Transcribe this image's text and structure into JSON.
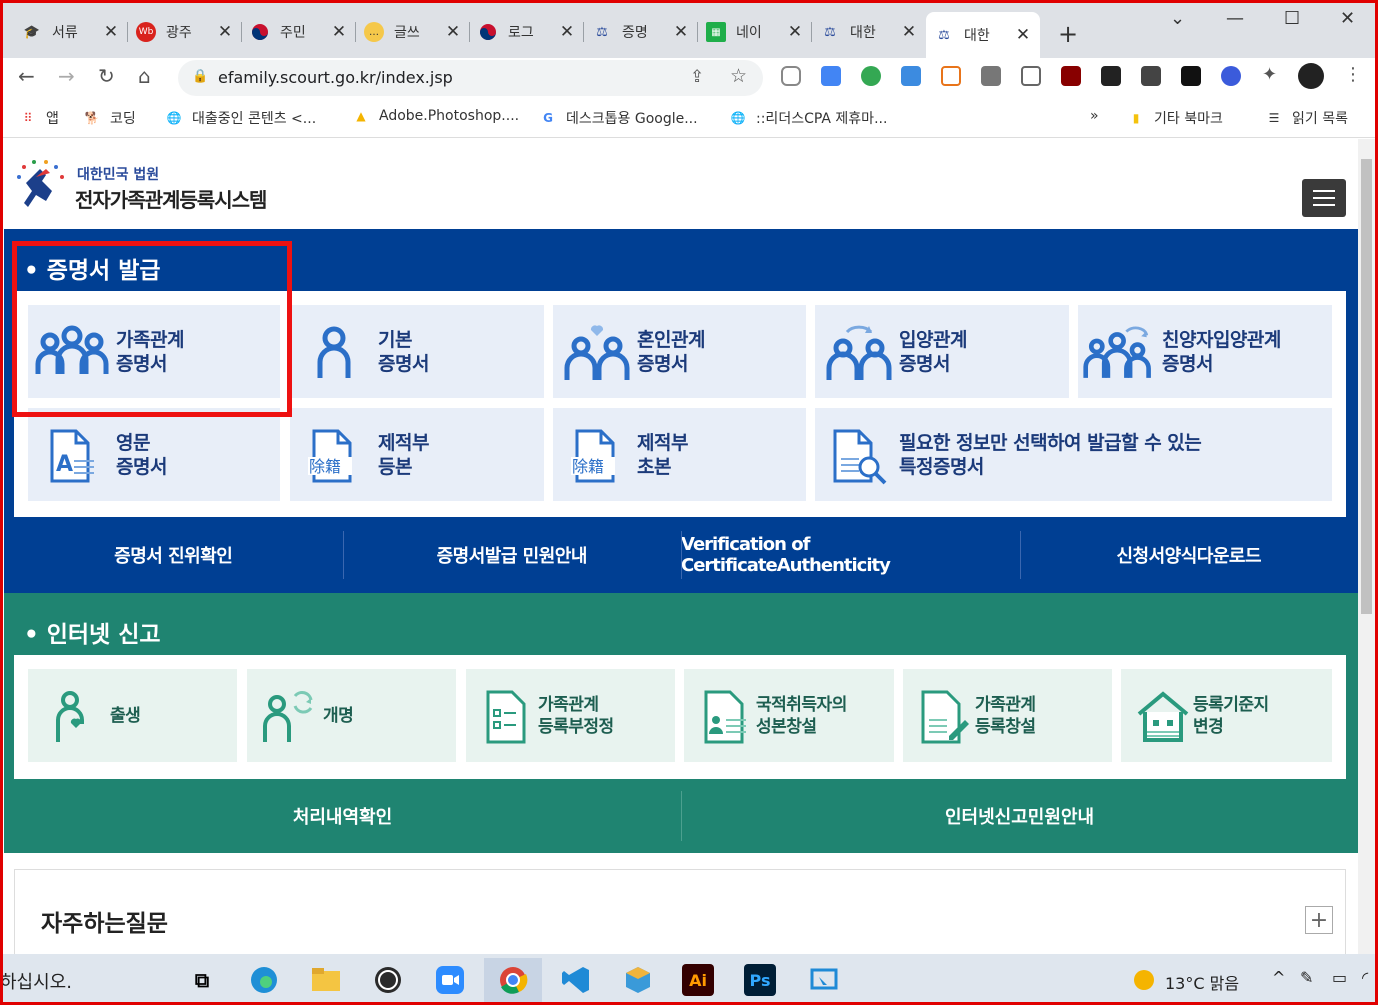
{
  "browser": {
    "tabs": [
      {
        "title": "서류"
      },
      {
        "title": "광주"
      },
      {
        "title": "주민"
      },
      {
        "title": "글쓰"
      },
      {
        "title": "로그"
      },
      {
        "title": "증명"
      },
      {
        "title": "네이"
      },
      {
        "title": "대한"
      },
      {
        "title": "대한"
      }
    ],
    "new_tab": "+",
    "url": "efamily.scourt.go.kr/index.jsp",
    "bookmarks": [
      {
        "label": "앱"
      },
      {
        "label": "코딩"
      },
      {
        "label": "대출중인 콘텐츠 <..."
      },
      {
        "label": "Adobe.Photoshop...."
      },
      {
        "label": "데스크톱용 Google..."
      },
      {
        "label": "::리더스CPA 제휴마..."
      }
    ],
    "bookmarks_more": "»",
    "other_bookmarks": "기타 북마크",
    "reading_list": "읽기 목록"
  },
  "site": {
    "logo_sub": "대한민국 법원",
    "logo_title": "전자가족관계등록시스템"
  },
  "cert": {
    "title": "• 증명서 발급",
    "cards": [
      {
        "line1": "가족관계",
        "line2": "증명서",
        "icon": "family-icon"
      },
      {
        "line1": "기본",
        "line2": "증명서",
        "icon": "person-icon"
      },
      {
        "line1": "혼인관계",
        "line2": "증명서",
        "icon": "marriage-icon"
      },
      {
        "line1": "입양관계",
        "line2": "증명서",
        "icon": "adoption-icon"
      },
      {
        "line1": "친양자입양관계",
        "line2": "증명서",
        "icon": "full-adoption-icon"
      },
      {
        "line1": "영문",
        "line2": "증명서",
        "icon": "english-doc-icon"
      },
      {
        "line1": "제적부",
        "line2": "등본",
        "icon": "removed-register-icon"
      },
      {
        "line1": "제적부",
        "line2": "초본",
        "icon": "removed-register-icon"
      },
      {
        "line1": "필요한 정보만 선택하여 발급할 수 있는",
        "line2": "특정증명서",
        "icon": "search-doc-icon"
      }
    ],
    "doc_text": "除籍",
    "links": [
      "증명서 진위확인",
      "증명서발급 민원안내",
      "Verification of CertificateAuthenticity",
      "신청서양식다운로드"
    ]
  },
  "net": {
    "title": "• 인터넷 신고",
    "cards": [
      {
        "line1": "출생",
        "line2": ""
      },
      {
        "line1": "개명",
        "line2": ""
      },
      {
        "line1": "가족관계",
        "line2": "등록부정정"
      },
      {
        "line1": "국적취득자의",
        "line2": "성본창설"
      },
      {
        "line1": "가족관계",
        "line2": "등록창설"
      },
      {
        "line1": "등록기준지",
        "line2": "변경"
      }
    ],
    "links": [
      "처리내역확인",
      "인터넷신고민원안내"
    ]
  },
  "faq": {
    "title": "자주하는질문",
    "expand": "+"
  },
  "taskbar": {
    "search_text": "하십시오.",
    "weather": "13°C  맑음",
    "app_ai": "Ai",
    "app_ps": "Ps"
  },
  "colors": {
    "cert_bg": "#003f93",
    "net_bg": "#1f8471",
    "highlight": "#ee1111"
  }
}
